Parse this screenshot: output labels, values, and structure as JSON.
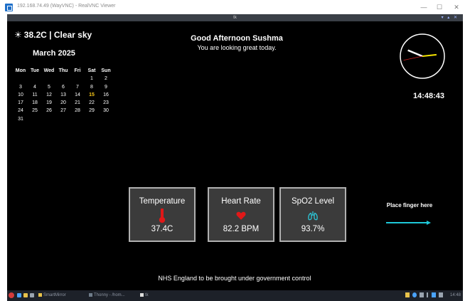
{
  "window": {
    "title": "192.168.74.49 (WayVNC) - RealVNC Viewer",
    "controls": {
      "minimize": "—",
      "maximize": "☐",
      "close": "✕"
    },
    "remote_title": "tk",
    "remote_controls": "▾ ▴ ✕"
  },
  "weather": {
    "icon": "☀",
    "text": "38.2C | Clear sky"
  },
  "calendar": {
    "title": "March 2025",
    "headers": [
      "Mon",
      "Tue",
      "Wed",
      "Thu",
      "Fri",
      "Sat",
      "Sun"
    ],
    "weeks": [
      [
        "",
        "",
        "",
        "",
        "",
        "1",
        "2"
      ],
      [
        "3",
        "4",
        "5",
        "6",
        "7",
        "8",
        "9"
      ],
      [
        "10",
        "11",
        "12",
        "13",
        "14",
        "15",
        "16"
      ],
      [
        "17",
        "18",
        "19",
        "20",
        "21",
        "22",
        "23"
      ],
      [
        "24",
        "25",
        "26",
        "27",
        "28",
        "29",
        "30"
      ],
      [
        "31",
        "",
        "",
        "",
        "",
        "",
        ""
      ]
    ],
    "today": "15",
    "today_color": "#f5c518"
  },
  "greeting": {
    "main": "Good Afternoon Sushma",
    "sub": "You are looking great today."
  },
  "clock": {
    "time": "14:48:43",
    "hand_colors": {
      "hour": "#f5e400",
      "minute": "#ffffff",
      "second": "#d42020"
    }
  },
  "cards": [
    {
      "title": "Temperature",
      "icon": "thermometer-icon",
      "value": "37.4C",
      "icon_color": "#e01818"
    },
    {
      "title": "Heart Rate",
      "icon": "heart-icon",
      "value": "82.2 BPM",
      "icon_color": "#e01818"
    },
    {
      "title": "SpO2 Level",
      "icon": "lungs-icon",
      "value": "93.7%",
      "icon_color": "#2cc5d6"
    }
  ],
  "finger": {
    "label": "Place finger here",
    "arrow_color": "#1ec8d8"
  },
  "news": {
    "headline": "NHS England to be brought under government control"
  },
  "taskbar": {
    "items": [
      "SmartMirror",
      "Thonny - /hom...",
      "tk"
    ],
    "time": "14:48"
  }
}
